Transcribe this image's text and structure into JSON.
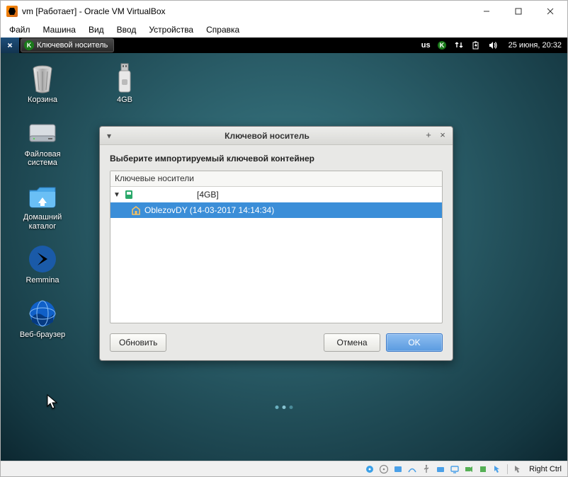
{
  "vbox": {
    "title": "vm [Работает] - Oracle VM VirtualBox",
    "menu": {
      "file": "Файл",
      "machine": "Машина",
      "view": "Вид",
      "input": "Ввод",
      "devices": "Устройства",
      "help": "Справка"
    },
    "status": {
      "hostkey": "Right Ctrl"
    }
  },
  "xfce": {
    "taskbar_app": "Ключевой носитель",
    "kbd_layout": "us",
    "clock": "25 июня, 20:32"
  },
  "desktop": {
    "trash": "Корзина",
    "fs": "Файловая система",
    "home": "Домашний каталог",
    "remmina": "Remmina",
    "browser": "Веб-браузер",
    "usb": "4GB"
  },
  "dialog": {
    "title": "Ключевой носитель",
    "instruction": "Выберите импортируемый ключевой контейнер",
    "tree_header": "Ключевые носители",
    "node_parent": "[4GB]",
    "node_child": "OblezovDY (14-03-2017 14:14:34)",
    "refresh": "Обновить",
    "cancel": "Отмена",
    "ok": "OK"
  }
}
